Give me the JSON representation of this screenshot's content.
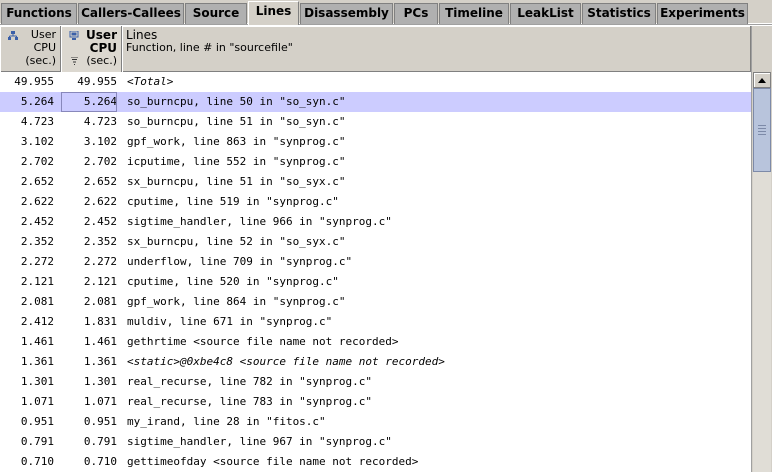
{
  "tabs": [
    {
      "label": "Functions",
      "active": false
    },
    {
      "label": "Callers-Callees",
      "active": false
    },
    {
      "label": "Source",
      "active": false
    },
    {
      "label": "Lines",
      "active": true
    },
    {
      "label": "Disassembly",
      "active": false
    },
    {
      "label": "PCs",
      "active": false
    },
    {
      "label": "Timeline",
      "active": false
    },
    {
      "label": "LeakList",
      "active": false
    },
    {
      "label": "Statistics",
      "active": false
    },
    {
      "label": "Experiments",
      "active": false
    }
  ],
  "columns": {
    "excl_user_cpu": {
      "line1": "User",
      "line2": "CPU",
      "line3": "(sec.)",
      "icon": "hierarchy-icon"
    },
    "incl_user_cpu": {
      "line1": "User",
      "line2": "CPU",
      "line3": "(sec.)",
      "icon": "computer-icon",
      "sort": "descending"
    },
    "lines": {
      "title": "Lines",
      "subtitle": "Function, line # in \"sourcefile\""
    }
  },
  "rows": [
    {
      "v1": "49.955",
      "v2": "49.955",
      "name": "<Total>",
      "italic": true
    },
    {
      "v1": "5.264",
      "v2": "5.264",
      "name": "so_burncpu, line 50 in \"so_syn.c\"",
      "selected": true
    },
    {
      "v1": "4.723",
      "v2": "4.723",
      "name": "so_burncpu, line 51 in \"so_syn.c\""
    },
    {
      "v1": "3.102",
      "v2": "3.102",
      "name": "gpf_work, line 863 in \"synprog.c\""
    },
    {
      "v1": "2.702",
      "v2": "2.702",
      "name": "icputime, line 552 in \"synprog.c\""
    },
    {
      "v1": "2.652",
      "v2": "2.652",
      "name": "sx_burncpu, line 51 in \"so_syx.c\""
    },
    {
      "v1": "2.622",
      "v2": "2.622",
      "name": "cputime, line 519 in \"synprog.c\""
    },
    {
      "v1": "2.452",
      "v2": "2.452",
      "name": "sigtime_handler, line 966 in \"synprog.c\""
    },
    {
      "v1": "2.352",
      "v2": "2.352",
      "name": "sx_burncpu, line 52 in \"so_syx.c\""
    },
    {
      "v1": "2.272",
      "v2": "2.272",
      "name": "underflow, line 709 in \"synprog.c\""
    },
    {
      "v1": "2.121",
      "v2": "2.121",
      "name": "cputime, line 520 in \"synprog.c\""
    },
    {
      "v1": "2.081",
      "v2": "2.081",
      "name": "gpf_work, line 864 in \"synprog.c\""
    },
    {
      "v1": "2.412",
      "v2": "1.831",
      "name": "muldiv, line 671 in \"synprog.c\""
    },
    {
      "v1": "1.461",
      "v2": "1.461",
      "name": "gethrtime <source file name not recorded>"
    },
    {
      "v1": "1.361",
      "v2": "1.361",
      "name": "<static>@0xbe4c8 <source file name not recorded>",
      "italic": true
    },
    {
      "v1": "1.301",
      "v2": "1.301",
      "name": "real_recurse, line 782 in \"synprog.c\""
    },
    {
      "v1": "1.071",
      "v2": "1.071",
      "name": "real_recurse, line 783 in \"synprog.c\""
    },
    {
      "v1": "0.951",
      "v2": "0.951",
      "name": "my_irand, line 28 in \"fitos.c\""
    },
    {
      "v1": "0.791",
      "v2": "0.791",
      "name": "sigtime_handler, line 967 in \"synprog.c\""
    },
    {
      "v1": "0.710",
      "v2": "0.710",
      "name": "gettimeofday <source file name not recorded>"
    }
  ],
  "colors": {
    "selection": "#ccccff",
    "panel": "#d4d0c8"
  }
}
